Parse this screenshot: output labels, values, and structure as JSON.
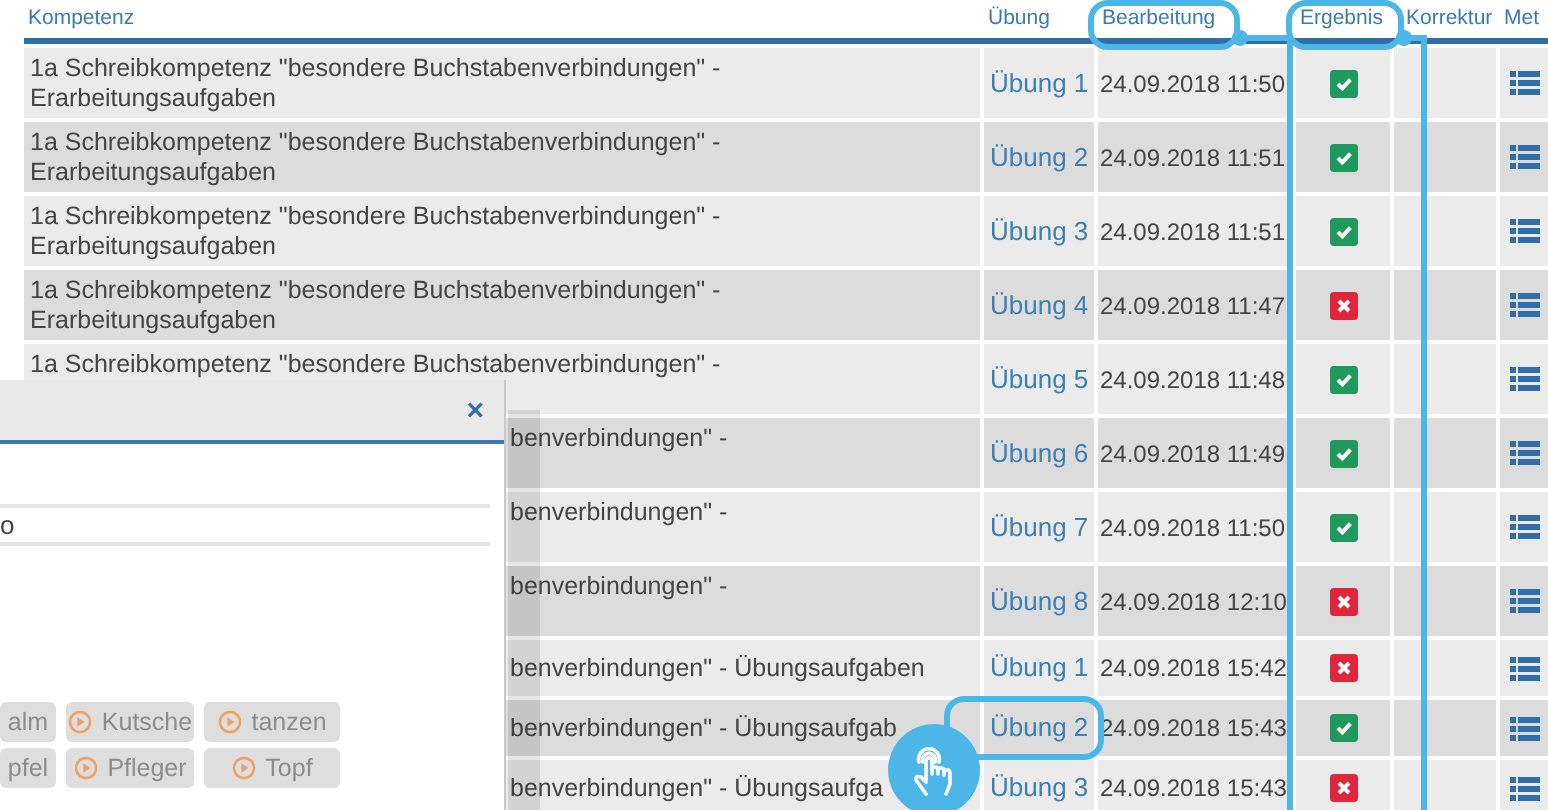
{
  "table": {
    "columns": [
      {
        "label": "Kompetenz",
        "highlighted": false
      },
      {
        "label": "Übung",
        "highlighted": false
      },
      {
        "label": "Bearbeitung",
        "highlighted": true
      },
      {
        "label": "Ergebnis",
        "highlighted": true
      },
      {
        "label": "Korrektur",
        "highlighted": false
      },
      {
        "label": "Met",
        "highlighted": false
      }
    ],
    "rows": [
      {
        "kind": "full",
        "tall": true,
        "kompetenz": "1a Schreibkompetenz \"besondere Buchstabenverbindungen\" - Erarbeitungsaufgaben",
        "exercise": "Übung 1",
        "highlighted": false,
        "edited": "24.09.2018 11:50",
        "passed": true
      },
      {
        "kind": "full",
        "tall": true,
        "kompetenz": "1a Schreibkompetenz \"besondere Buchstabenverbindungen\" - Erarbeitungsaufgaben",
        "exercise": "Übung 2",
        "highlighted": false,
        "edited": "24.09.2018 11:51",
        "passed": true
      },
      {
        "kind": "full",
        "tall": true,
        "kompetenz": "1a Schreibkompetenz \"besondere Buchstabenverbindungen\" - Erarbeitungsaufgaben",
        "exercise": "Übung 3",
        "highlighted": false,
        "edited": "24.09.2018 11:51",
        "passed": true
      },
      {
        "kind": "full",
        "tall": true,
        "kompetenz": "1a Schreibkompetenz \"besondere Buchstabenverbindungen\" - Erarbeitungsaufgaben",
        "exercise": "Übung 4",
        "highlighted": false,
        "edited": "24.09.2018 11:47",
        "passed": false
      },
      {
        "kind": "full",
        "tall": true,
        "kompetenz": "1a Schreibkompetenz \"besondere Buchstabenverbindungen\" -",
        "exercise": "Übung 5",
        "highlighted": false,
        "edited": "24.09.2018 11:48",
        "passed": true
      },
      {
        "kind": "clipped",
        "tall": true,
        "kompetenz": "benverbindungen\" -",
        "exercise": "Übung 6",
        "highlighted": false,
        "edited": "24.09.2018 11:49",
        "passed": true
      },
      {
        "kind": "clipped",
        "tall": true,
        "kompetenz": "benverbindungen\" -",
        "exercise": "Übung 7",
        "highlighted": false,
        "edited": "24.09.2018 11:50",
        "passed": true
      },
      {
        "kind": "clipped",
        "tall": true,
        "kompetenz": "benverbindungen\" -",
        "exercise": "Übung 8",
        "highlighted": false,
        "edited": "24.09.2018 12:10",
        "passed": false
      },
      {
        "kind": "clipped",
        "tall": false,
        "kompetenz": "benverbindungen\" - Übungsaufgaben",
        "exercise": "Übung 1",
        "highlighted": false,
        "edited": "24.09.2018 15:42",
        "passed": false
      },
      {
        "kind": "clipped",
        "tall": false,
        "kompetenz": "benverbindungen\" - Übungsaufgab",
        "exercise": "Übung 2",
        "highlighted": true,
        "edited": "24.09.2018 15:43",
        "passed": true
      },
      {
        "kind": "clipped",
        "tall": false,
        "kompetenz": "benverbindungen\" - Übungsaufga",
        "exercise": "Übung 3",
        "highlighted": false,
        "edited": "24.09.2018 15:43",
        "passed": false
      }
    ]
  },
  "dialog": {
    "close": "×",
    "field_value": "o",
    "buttons": [
      {
        "label": "alm",
        "icon": false
      },
      {
        "label": "Kutsche",
        "icon": true
      },
      {
        "label": "tanzen",
        "icon": true
      },
      {
        "label": "pfel",
        "icon": false
      },
      {
        "label": "Pfleger",
        "icon": true
      },
      {
        "label": "Topf",
        "icon": true
      }
    ]
  }
}
